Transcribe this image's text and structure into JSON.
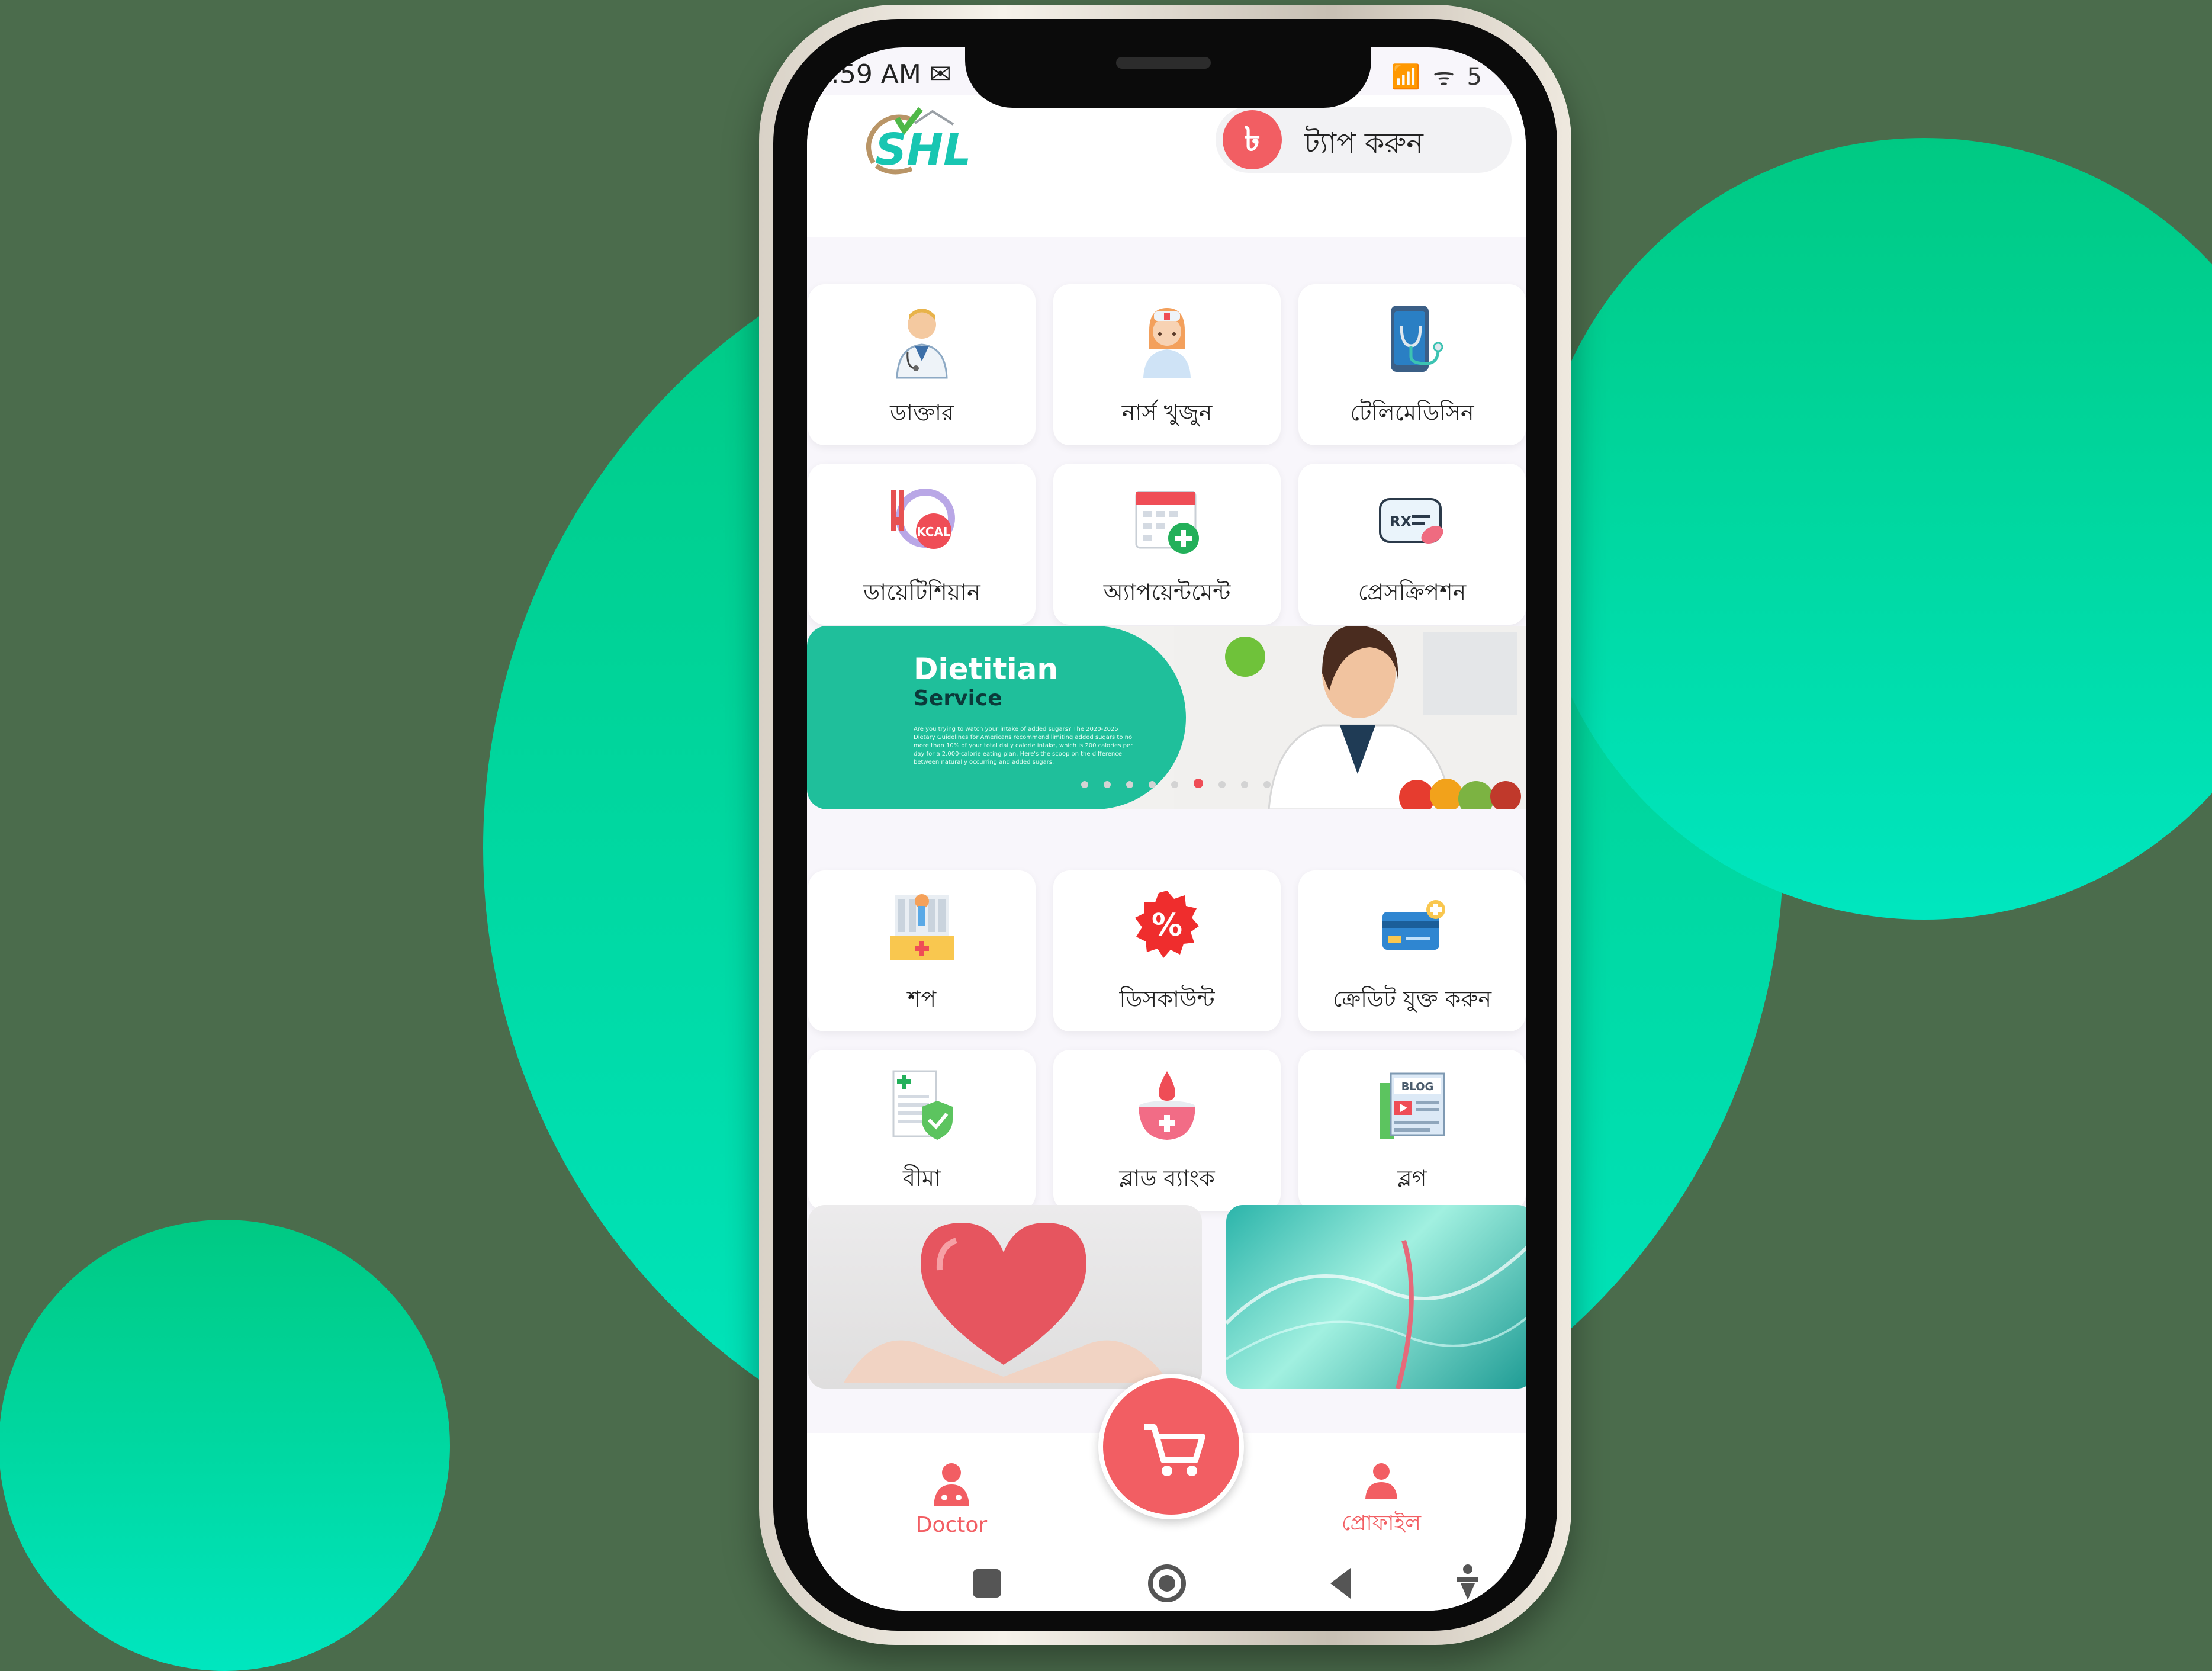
{
  "background_color": "#4b6c4c",
  "status_bar": {
    "time": ":59 AM",
    "mail_glyph": "✉",
    "icons": "📶 ᯤ 5"
  },
  "header": {
    "logo_text": "SHL",
    "tap_button_icon": "৳",
    "tap_button_label": "ট্যাপ করুন"
  },
  "services_row1": [
    {
      "label": "ডাক্তার",
      "icon": "doctor-icon"
    },
    {
      "label": "নার্স খুজুন",
      "icon": "nurse-icon"
    },
    {
      "label": "টেলিমেডিসিন",
      "icon": "telemedicine-icon"
    }
  ],
  "services_row2": [
    {
      "label": "ডায়েটিশিয়ান",
      "icon": "kcal-icon"
    },
    {
      "label": "অ্যাপয়েন্টমেন্ট",
      "icon": "calendar-icon"
    },
    {
      "label": "প্রেসক্রিপশন",
      "icon": "prescription-icon"
    }
  ],
  "banner": {
    "title": "Dietitian",
    "subtitle": "Service",
    "copy": "Are you trying to watch your intake of added sugars? The 2020-2025 Dietary Guidelines for Americans recommend limiting added sugars to no more than 10% of your total daily calorie intake, which is 200 calories per day for a 2,000-calorie eating plan. Here's the scoop on the difference between naturally occurring and added sugars.",
    "slide_count": 9,
    "active_slide": 6
  },
  "services_row3": [
    {
      "label": "শপ",
      "icon": "shop-icon"
    },
    {
      "label": "ডিসকাউন্ট",
      "icon": "discount-icon"
    },
    {
      "label": "ক্রেডিট যুক্ত করুন",
      "icon": "credit-card-icon"
    }
  ],
  "services_row4": [
    {
      "label": "বীমা",
      "icon": "insurance-icon"
    },
    {
      "label": "ব্লাড ব্যাংক",
      "icon": "blood-bank-icon"
    },
    {
      "label": "ব্লগ",
      "icon": "blog-icon"
    }
  ],
  "blog_label": "BLOG",
  "bottom_nav": {
    "doctor_label": "Doctor",
    "profile_label": "প্রোফাইল"
  },
  "colors": {
    "accent": "#f25e63",
    "green": "#1fbf9b",
    "circle_top": "#00c983",
    "circle_bottom": "#00e6bf"
  }
}
